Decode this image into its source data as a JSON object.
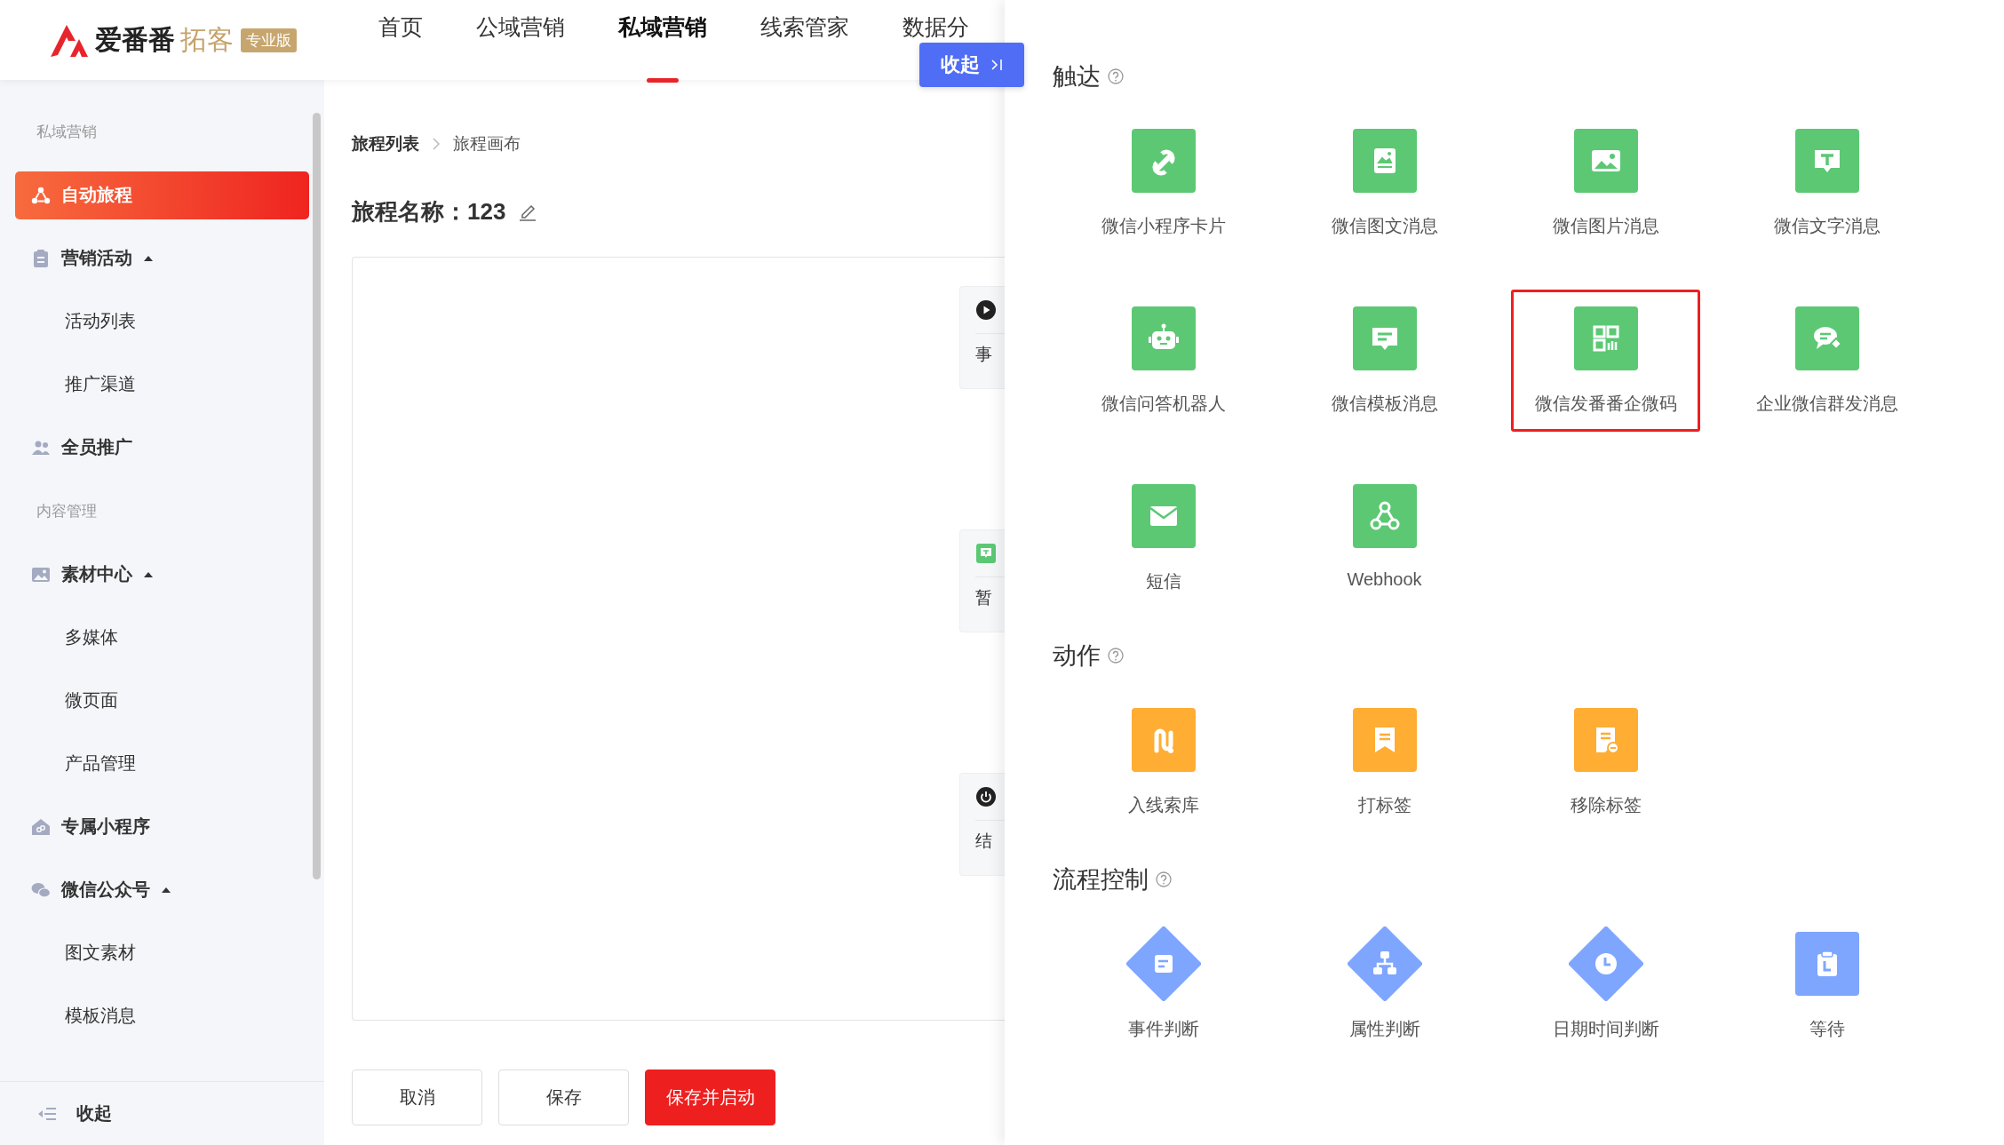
{
  "header": {
    "logo": {
      "name": "爱番番",
      "product": "拓客",
      "edition": "专业版"
    },
    "nav": [
      {
        "label": "首页",
        "selected": false
      },
      {
        "label": "公域营销",
        "selected": false
      },
      {
        "label": "私域营销",
        "selected": true
      },
      {
        "label": "线索管家",
        "selected": false
      },
      {
        "label": "数据分",
        "selected": false
      }
    ],
    "collapse_button": {
      "label": "收起"
    }
  },
  "sidebar": {
    "groups": [
      {
        "title": "私域营销",
        "items": [
          {
            "label": "自动旅程",
            "selected": true
          },
          {
            "label": "营销活动",
            "selected": false,
            "expanded": true,
            "children": [
              {
                "label": "活动列表",
                "selected": false
              },
              {
                "label": "推广渠道",
                "selected": false
              }
            ]
          },
          {
            "label": "全员推广",
            "selected": false
          }
        ]
      },
      {
        "title": "内容管理",
        "items": [
          {
            "label": "素材中心",
            "selected": false,
            "expanded": true,
            "children": [
              {
                "label": "多媒体",
                "selected": false
              },
              {
                "label": "微页面",
                "selected": false
              },
              {
                "label": "产品管理",
                "selected": false
              }
            ]
          },
          {
            "label": "专属小程序",
            "selected": false
          },
          {
            "label": "微信公众号",
            "selected": false,
            "expanded": true,
            "children": [
              {
                "label": "图文素材",
                "selected": false
              },
              {
                "label": "模板消息",
                "selected": false
              }
            ]
          }
        ]
      }
    ],
    "footer": {
      "label": "收起"
    }
  },
  "breadcrumb": [
    "旅程列表",
    "旅程画布"
  ],
  "title": "旅程名称：123",
  "canvas": {
    "nodes": [
      {
        "kind": "start",
        "label": "事"
      },
      {
        "kind": "message",
        "label": "暂"
      },
      {
        "kind": "end",
        "label": "结"
      }
    ]
  },
  "buttons": [
    {
      "label": "取消",
      "kind": "default"
    },
    {
      "label": "保存",
      "kind": "default"
    },
    {
      "label": "保存并启动",
      "kind": "primary"
    }
  ],
  "panel": {
    "sections": [
      {
        "title": "触达",
        "color": "#5cc874",
        "items": [
          {
            "label": "微信小程序卡片",
            "selected": false
          },
          {
            "label": "微信图文消息",
            "selected": false
          },
          {
            "label": "微信图片消息",
            "selected": false
          },
          {
            "label": "微信文字消息",
            "selected": false
          },
          {
            "label": "微信问答机器人",
            "selected": false
          },
          {
            "label": "微信模板消息",
            "selected": false
          },
          {
            "label": "微信发番番企微码",
            "selected": true
          },
          {
            "label": "企业微信群发消息",
            "selected": false
          },
          {
            "label": "短信",
            "selected": false
          },
          {
            "label": "Webhook",
            "selected": false
          }
        ]
      },
      {
        "title": "动作",
        "color": "#ffad33",
        "items": [
          {
            "label": "入线索库",
            "selected": false
          },
          {
            "label": "打标签",
            "selected": false
          },
          {
            "label": "移除标签",
            "selected": false
          }
        ]
      },
      {
        "title": "流程控制",
        "color": "#7ea6ff",
        "items": [
          {
            "label": "事件判断",
            "selected": false,
            "kind": "diamond"
          },
          {
            "label": "属性判断",
            "selected": false,
            "kind": "diamond"
          },
          {
            "label": "日期时间判断",
            "selected": false,
            "kind": "diamond"
          },
          {
            "label": "等待",
            "selected": false,
            "kind": "square"
          }
        ]
      }
    ]
  }
}
